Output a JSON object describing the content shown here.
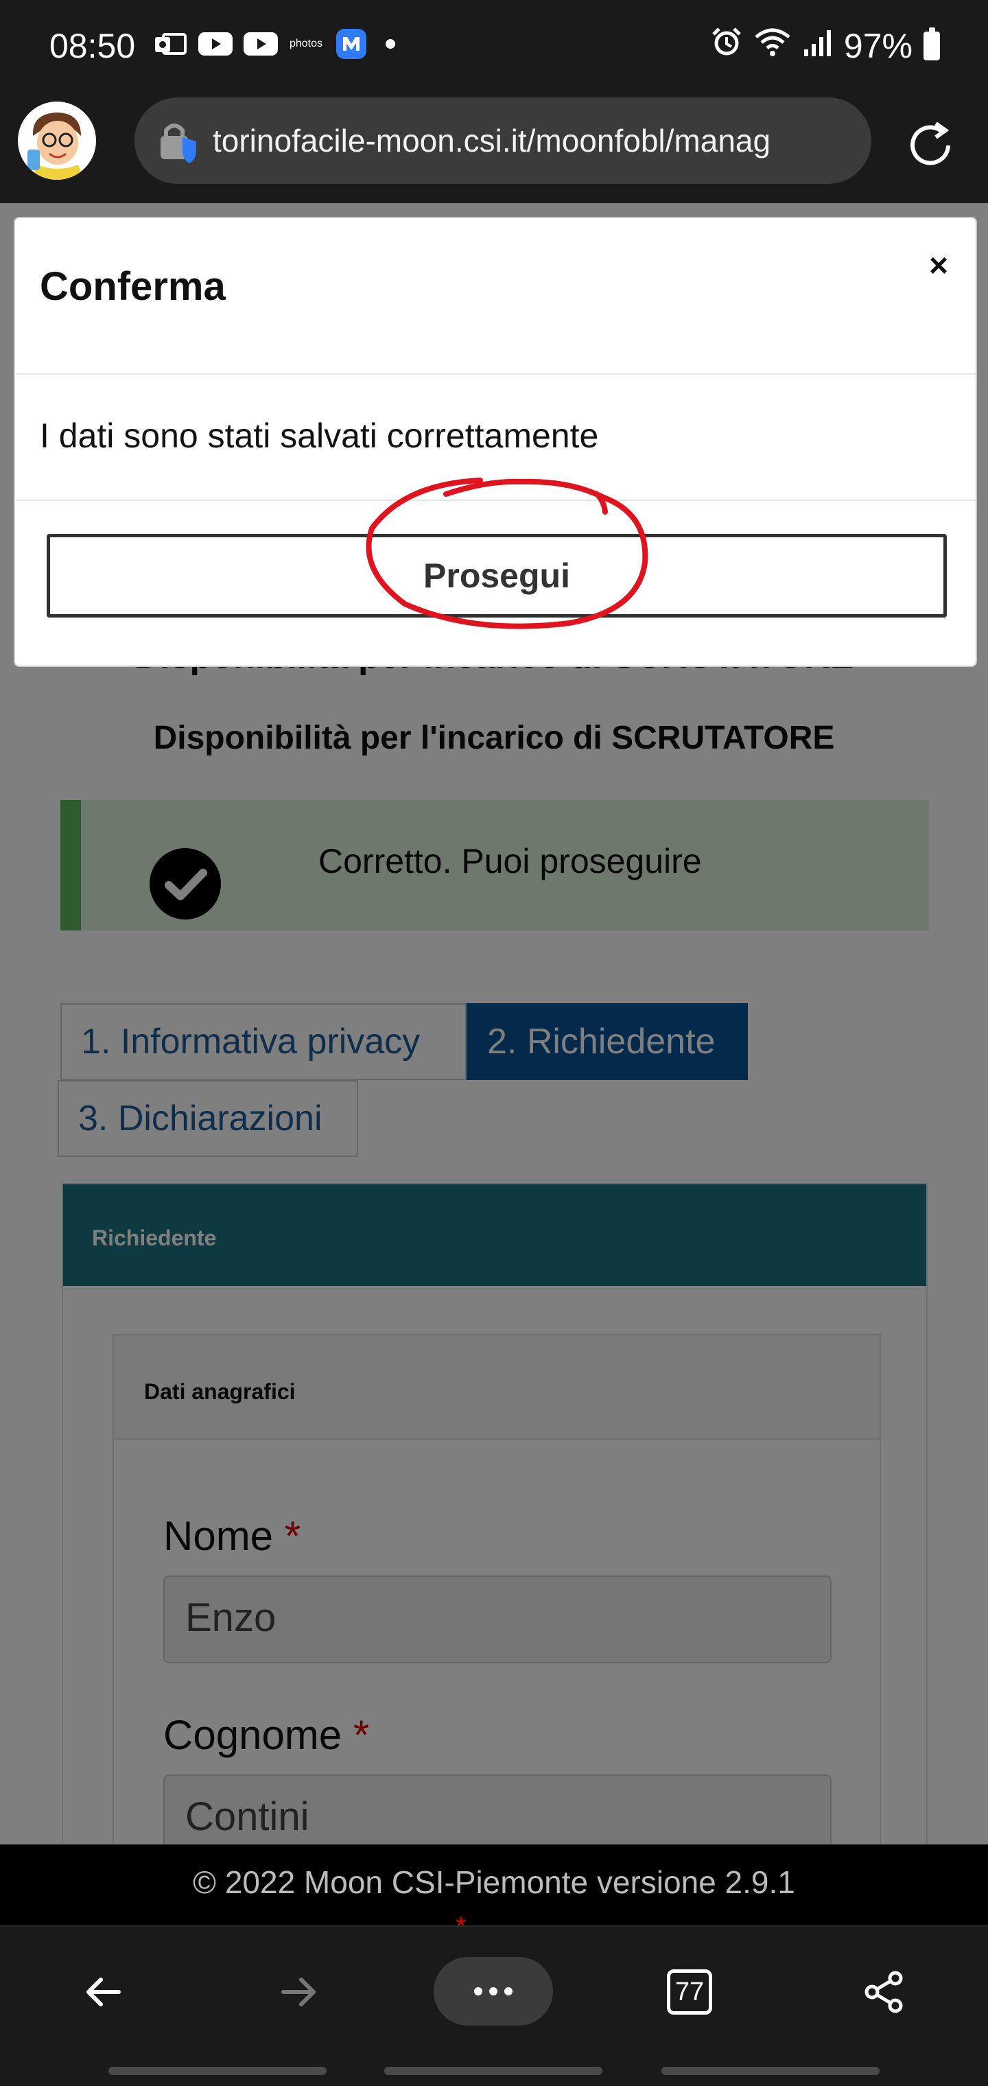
{
  "status_bar": {
    "time": "08:50",
    "photos_label": "photos",
    "battery": "97%",
    "icons": [
      "outlook-icon",
      "youtube-icon",
      "youtube-icon",
      "amazon-photos-icon",
      "messenger-icon",
      "dot-icon",
      "alarm-icon",
      "wifi-icon",
      "signal-icon",
      "battery-icon"
    ]
  },
  "browser": {
    "url": "torinofacile-moon.csi.it/moonfobl/manag",
    "icons": [
      "avatar",
      "lock-shield-icon",
      "reload-icon"
    ]
  },
  "page": {
    "title_behind": "Disponibilità per incarico di SCRUTATORE",
    "title": "Disponibilità per l'incarico di SCRUTATORE",
    "alert_text": "Corretto. Puoi proseguire",
    "tabs": [
      {
        "label": "1. Informativa privacy",
        "active": false
      },
      {
        "label": "2. Richiedente",
        "active": true
      },
      {
        "label": "3. Dichiarazioni",
        "active": false
      }
    ],
    "panel_title": "Richiedente",
    "subpanel_title": "Dati anagrafici",
    "fields": [
      {
        "label": "Nome",
        "required_mark": "*",
        "value": "Enzo"
      },
      {
        "label": "Cognome",
        "required_mark": "*",
        "value": "Contini"
      }
    ],
    "footer": "© 2022 Moon CSI-Piemonte versione 2.9.1",
    "footer_star": "*"
  },
  "modal": {
    "title": "Conferma",
    "close": "×",
    "message": "I dati sono stati salvati correttamente",
    "button_label": "Prosegui"
  },
  "nav": {
    "tab_count": "77",
    "icons": [
      "back-arrow-icon",
      "forward-arrow-icon",
      "more-icon",
      "tabs-icon",
      "share-icon"
    ]
  },
  "colors": {
    "accent_tab": "#0b5394",
    "panel_header": "#1a7580",
    "alert_bg": "#dff0d8",
    "alert_border": "#5cb85c",
    "annotation": "#e0141e"
  }
}
